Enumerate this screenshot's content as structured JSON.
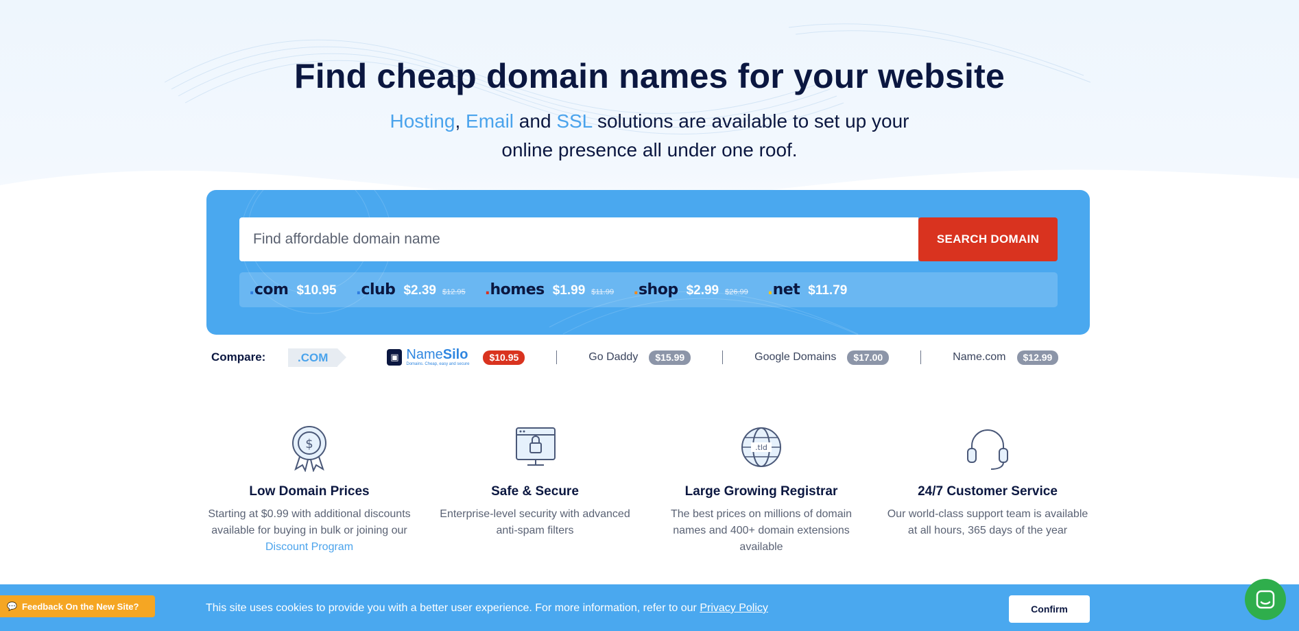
{
  "hero": {
    "title": "Find cheap domain names for your website",
    "subtitle_link1": "Hosting",
    "subtitle_sep1": ", ",
    "subtitle_link2": "Email",
    "subtitle_and": " and ",
    "subtitle_link3": "SSL",
    "subtitle_rest": " solutions are available to set up your online presence all under one roof."
  },
  "search": {
    "placeholder": "Find affordable domain name",
    "button_label": "SEARCH DOMAIN"
  },
  "tlds": [
    {
      "dot": ".",
      "name": "com",
      "price": "$10.95",
      "old_price": ""
    },
    {
      "dot": ".",
      "name": "club",
      "price": "$2.39",
      "old_price": "$12.95"
    },
    {
      "dot": ".",
      "name": "homes",
      "price": "$1.99",
      "old_price": "$11.99"
    },
    {
      "dot": ".",
      "name": "shop",
      "price": "$2.99",
      "old_price": "$26.99"
    },
    {
      "dot": ".",
      "name": "net",
      "price": "$11.79",
      "old_price": ""
    }
  ],
  "compare": {
    "label": "Compare:",
    "tld_tag": ".COM",
    "namesilo_name_a": "Name",
    "namesilo_name_b": "Silo",
    "namesilo_tagline": "Domains. Cheap, easy and secure",
    "namesilo_price": "$10.95",
    "competitors": [
      {
        "name": "Go Daddy",
        "price": "$15.99"
      },
      {
        "name": "Google Domains",
        "price": "$17.00"
      },
      {
        "name": "Name.com",
        "price": "$12.99"
      }
    ]
  },
  "features": [
    {
      "title": "Low Domain Prices",
      "desc": "Starting at $0.99 with additional discounts available for buying in bulk or joining our ",
      "link": "Discount Program",
      "icon": "price-badge-icon"
    },
    {
      "title": "Safe & Secure",
      "desc": "Enterprise-level security with advanced anti-spam filters",
      "link": "",
      "icon": "secure-browser-icon"
    },
    {
      "title": "Large Growing Registrar",
      "desc": "The best prices on millions of domain names and 400+ domain extensions available",
      "link": "",
      "icon": "globe-tld-icon"
    },
    {
      "title": "24/7 Customer Service",
      "desc": "Our world-class support team is available at all hours, 365 days of the year",
      "link": "",
      "icon": "headset-icon"
    }
  ],
  "tld_icon_text": ".tld",
  "cookie": {
    "text": "This site uses cookies to provide you with a better user experience. For more information, refer to our ",
    "policy_link": "Privacy Policy",
    "confirm_label": "Confirm"
  },
  "feedback": {
    "label": "Feedback On the New Site?"
  },
  "colors": {
    "navy": "#0b1740",
    "accent_blue": "#4aa8ef",
    "link_blue": "#4aa3ec",
    "cta_red": "#d9331f",
    "feedback_orange": "#f5a623",
    "chat_green": "#2fae4c"
  }
}
